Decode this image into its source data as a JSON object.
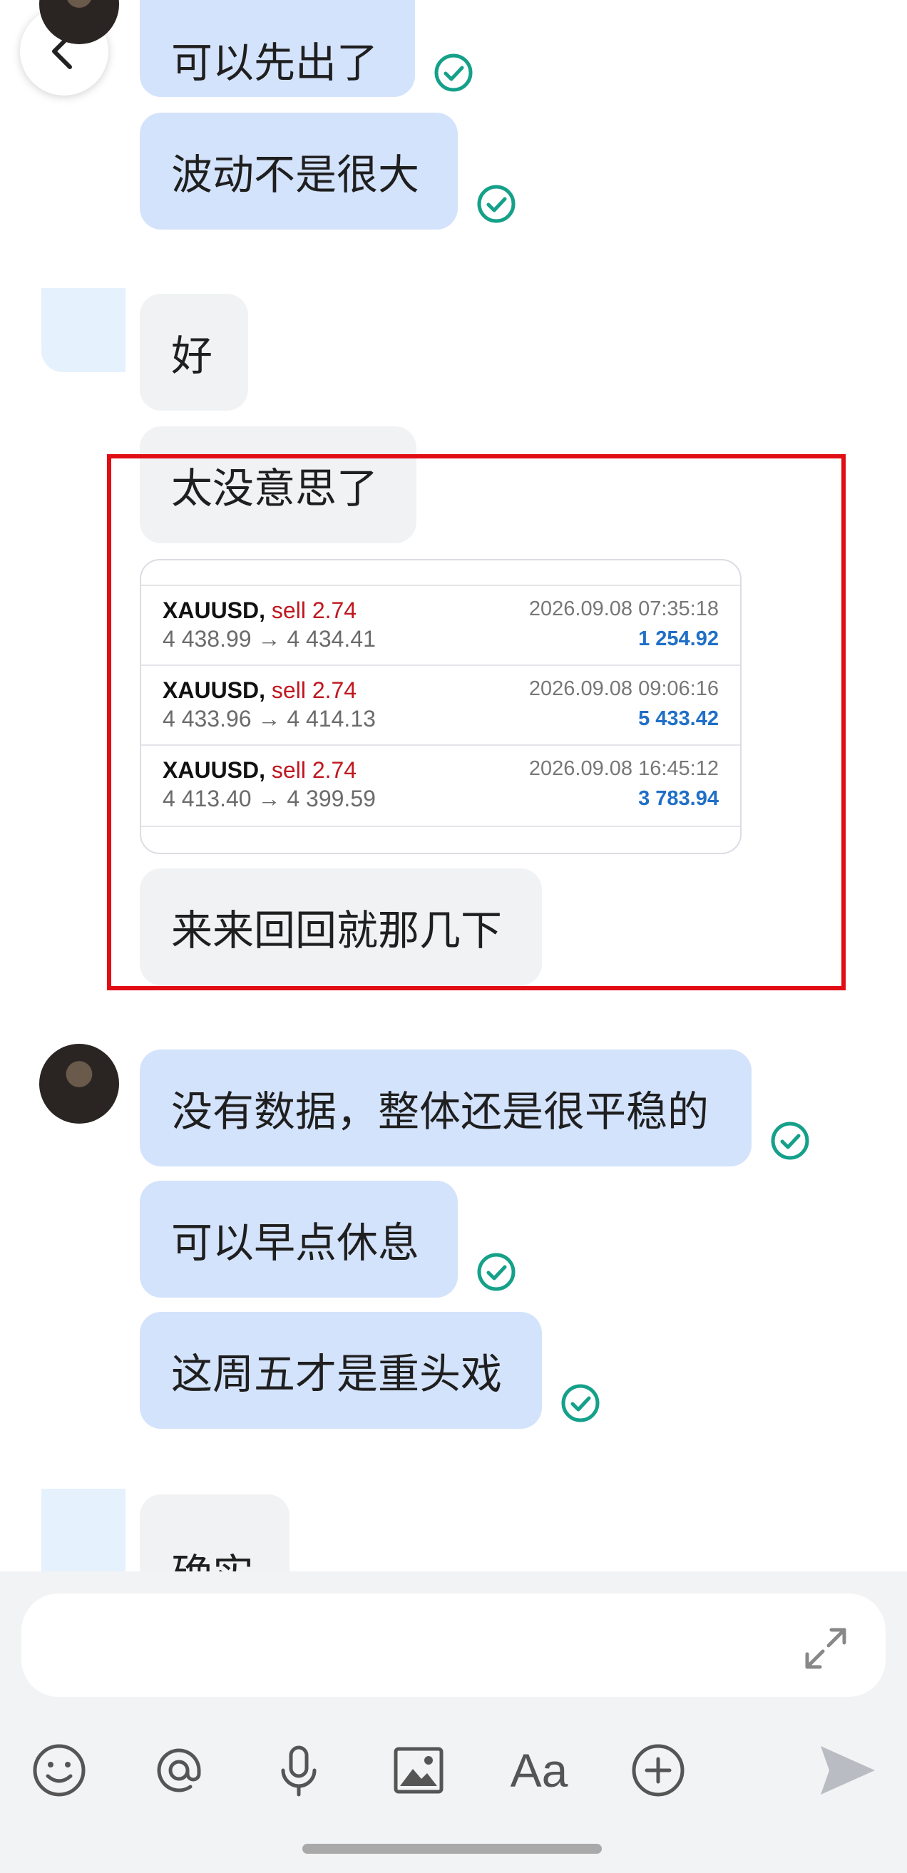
{
  "colors": {
    "outgoing_bubble": "#d4e3fc",
    "incoming_bubble": "#f1f2f4",
    "check": "#15a08a",
    "sell": "#c0171f",
    "profit": "#1f6fc7",
    "highlight_box": "#e10d14"
  },
  "messages": {
    "m1": "可以先出了",
    "m2": "波动不是很大",
    "m3": "好",
    "m4": "太没意思了",
    "m5": "来来回回就那几下",
    "m6": "没有数据，整体还是很平稳的",
    "m7": "可以早点休息",
    "m8": "这周五才是重头戏",
    "m9": "确实"
  },
  "trades": [
    {
      "symbol": "XAUUSD,",
      "side": "sell 2.74",
      "prices": "4 438.99 → 4 434.41",
      "time": "2026.09.08 07:35:18",
      "profit": "1 254.92"
    },
    {
      "symbol": "XAUUSD,",
      "side": "sell 2.74",
      "prices": "4 433.96 → 4 414.13",
      "time": "2026.09.08 09:06:16",
      "profit": "5 433.42"
    },
    {
      "symbol": "XAUUSD,",
      "side": "sell 2.74",
      "prices": "4 413.40 → 4 399.59",
      "time": "2026.09.08 16:45:12",
      "profit": "3 783.94"
    }
  ],
  "toolbar": {
    "icons": [
      "emoji-icon",
      "mention-icon",
      "microphone-icon",
      "image-icon",
      "text-format-icon",
      "add-icon",
      "send-icon"
    ],
    "format_label": "Aa"
  }
}
